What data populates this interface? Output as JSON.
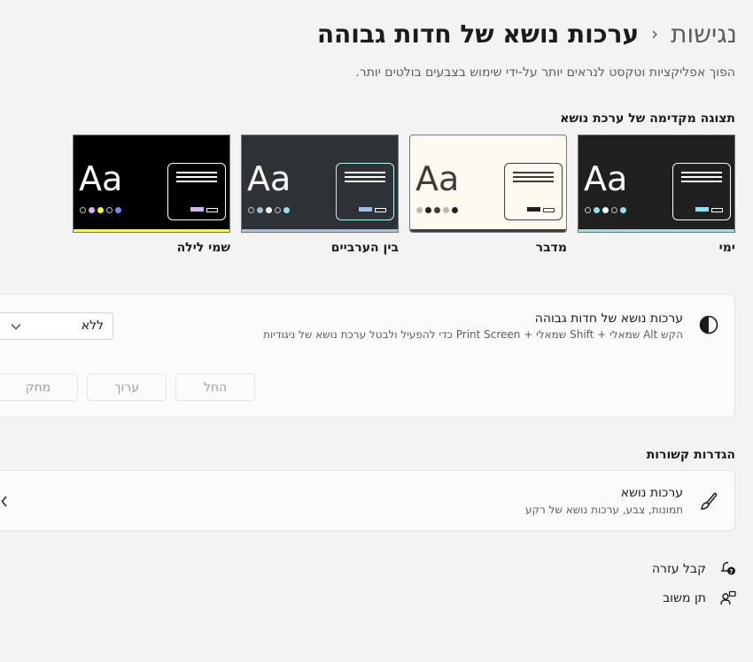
{
  "breadcrumb": {
    "parent": "נגישות",
    "separator": "›",
    "current": "ערכות נושא של חדות גבוהה"
  },
  "description": "הפוך אפליקציות וטקסט לנראים יותר על-ידי שימוש בצבעים בולטים יותר.",
  "preview": {
    "title": "תצוגה מקדימה של ערכת נושא",
    "themes": [
      {
        "name": "ימי",
        "sample": "Aa",
        "colors": {
          "bg": "#202020",
          "text": "#ffffff",
          "border": "#ffffff",
          "accent": "#8ee3f0",
          "base": "#8ee3f0"
        }
      },
      {
        "name": "מדבר",
        "sample": "Aa",
        "colors": {
          "bg": "#fffaef",
          "text": "#3d3d3d",
          "border": "#3d3d3d",
          "accent": "#202020",
          "base": "#3d3d3d"
        }
      },
      {
        "name": "בין הערביים",
        "sample": "Aa",
        "colors": {
          "bg": "#2d3236",
          "text": "#ffffff",
          "border": "#b6f6f0",
          "accent": "#a1bfde",
          "base": "#a1bfde"
        }
      },
      {
        "name": "שמי לילה",
        "sample": "Aa",
        "colors": {
          "bg": "#000000",
          "text": "#ffffff",
          "border": "#ffffff",
          "accent": "#d6b4fd",
          "base": "#ffff00"
        }
      }
    ]
  },
  "contrast_setting": {
    "icon": "contrast-icon",
    "title": "ערכות נושא של חדות גבוהה",
    "subtitle": "הקש Alt שמאלי + Shift שמאלי + Print Screen כדי להפעיל ולבטל ערכת נושא של ניגודיות",
    "select_value": "ללא",
    "buttons": {
      "apply": "החל",
      "edit": "ערוך",
      "delete": "מחק"
    }
  },
  "related": {
    "title": "הגדרות קשורות",
    "item": {
      "icon": "paintbrush-icon",
      "title": "ערכות נושא",
      "subtitle": "תמונות, צבע, ערכות נושא של רקע"
    }
  },
  "footer": {
    "help": {
      "icon": "help-icon",
      "label": "קבל עזרה"
    },
    "feedback": {
      "icon": "feedback-icon",
      "label": "תן משוב"
    }
  }
}
